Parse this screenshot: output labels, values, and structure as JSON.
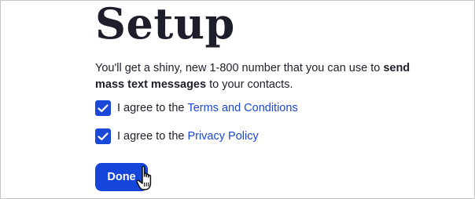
{
  "page": {
    "title": "Setup",
    "description_part1": "You'll get a shiny, new 1-800 number that you can use to ",
    "description_bold": "send mass text messages",
    "description_part2": " to your contacts."
  },
  "agreements": [
    {
      "prefix": "I agree to the",
      "link": "Terms and Conditions",
      "checked": true
    },
    {
      "prefix": "I agree to the",
      "link": "Privacy Policy",
      "checked": true
    }
  ],
  "done_button": {
    "label": "Done"
  },
  "colors": {
    "accent": "#1a48d8",
    "title_text": "#1d1d2b",
    "body_text": "#1f1f2b"
  },
  "icons": {
    "checkbox_mark": "check-icon",
    "cursor": "hand-pointer-icon"
  }
}
